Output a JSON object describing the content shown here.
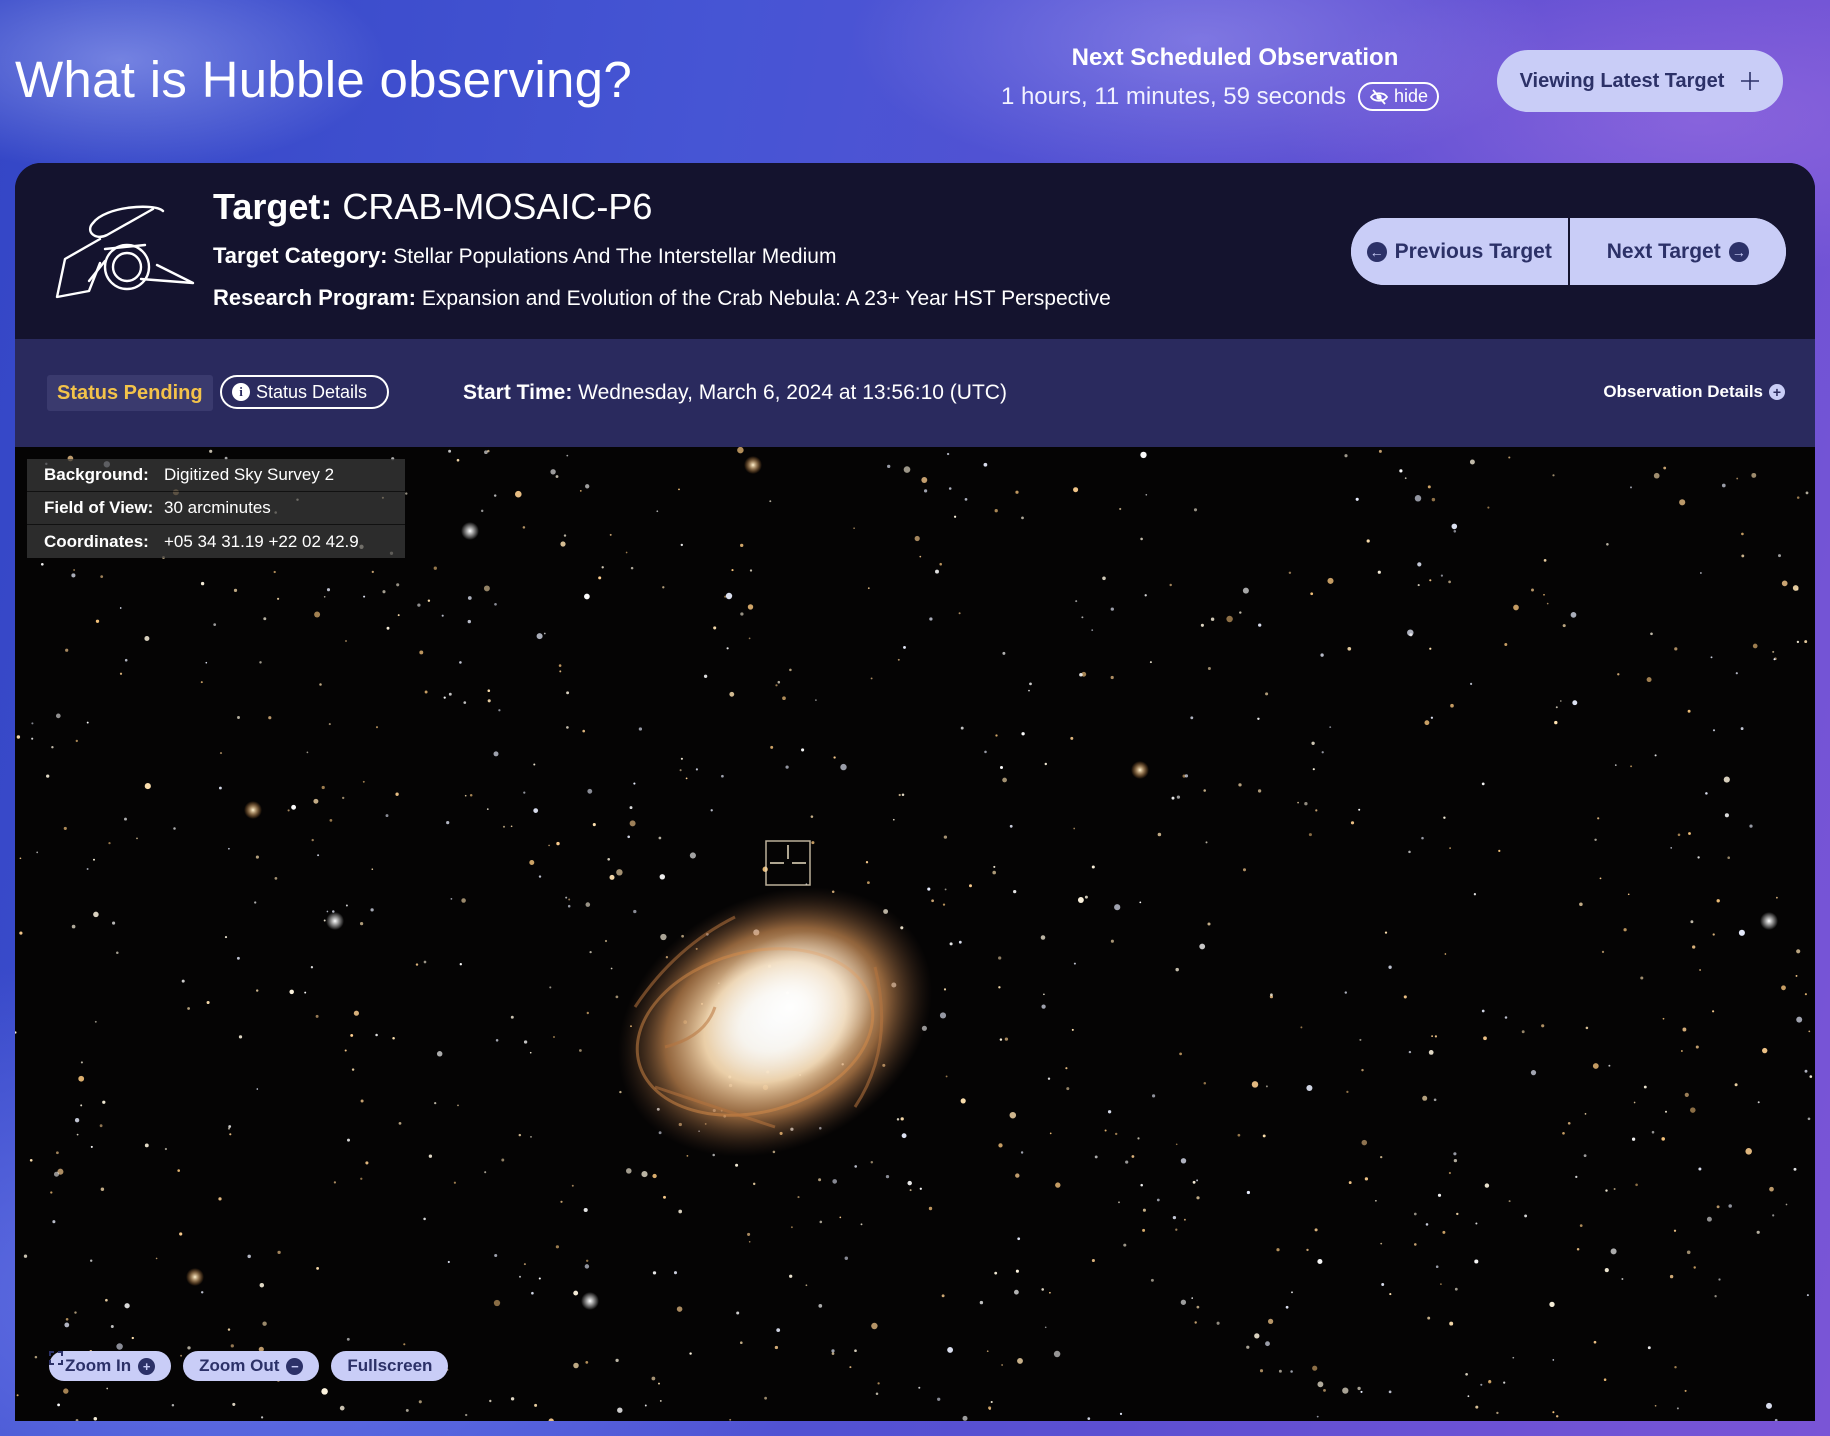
{
  "header": {
    "title": "What is Hubble observing?",
    "next_label": "Next Scheduled Observation",
    "countdown": "1 hours, 11 minutes, 59 seconds",
    "hide_label": "hide",
    "viewing_label": "Viewing Latest Target"
  },
  "target": {
    "title_label": "Target:",
    "name": "CRAB-MOSAIC-P6",
    "category_label": "Target Category:",
    "category": "Stellar Populations And The Interstellar Medium",
    "program_label": "Research Program:",
    "program": "Expansion and Evolution of the Crab Nebula: A 23+ Year HST Perspective",
    "prev_label": "Previous Target",
    "next_label": "Next Target"
  },
  "status": {
    "badge": "Status Pending",
    "details_label": "Status Details",
    "start_label": "Start Time:",
    "start_value": "Wednesday, March 6, 2024 at 13:56:10 (UTC)",
    "obs_details_label": "Observation Details"
  },
  "sky_info": [
    {
      "key": "Background:",
      "value": "Digitized Sky Survey 2"
    },
    {
      "key": "Field of View:",
      "value": "30 arcminutes"
    },
    {
      "key": "Coordinates:",
      "value": "+05 34 31.19 +22 02 42.9"
    }
  ],
  "controls": {
    "zoom_in": "Zoom In",
    "zoom_out": "Zoom Out",
    "fullscreen": "Fullscreen"
  },
  "colors": {
    "accent": "#c9cdf7",
    "accent_text": "#2c3168",
    "card_bg": "#14132e",
    "status_bar_bg": "#2a2a5e",
    "pending": "#f3c34a"
  }
}
